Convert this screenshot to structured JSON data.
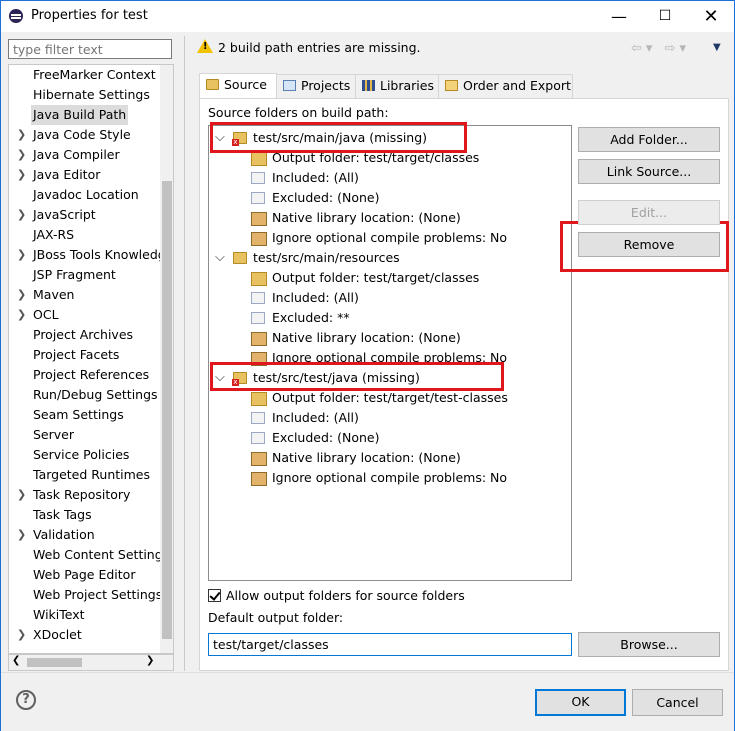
{
  "window": {
    "title": "Properties for test"
  },
  "left": {
    "filter_placeholder": "type filter text",
    "items": [
      {
        "label": "FreeMarker Context",
        "chevron": ""
      },
      {
        "label": "Hibernate Settings",
        "chevron": ""
      },
      {
        "label": "Java Build Path",
        "chevron": "",
        "selected": true
      },
      {
        "label": "Java Code Style",
        "chevron": ">"
      },
      {
        "label": "Java Compiler",
        "chevron": ">"
      },
      {
        "label": "Java Editor",
        "chevron": ">"
      },
      {
        "label": "Javadoc Location",
        "chevron": ""
      },
      {
        "label": "JavaScript",
        "chevron": ">"
      },
      {
        "label": "JAX-RS",
        "chevron": ""
      },
      {
        "label": "JBoss Tools Knowledg",
        "chevron": ">"
      },
      {
        "label": "JSP Fragment",
        "chevron": ""
      },
      {
        "label": "Maven",
        "chevron": ">"
      },
      {
        "label": "OCL",
        "chevron": ">"
      },
      {
        "label": "Project Archives",
        "chevron": ""
      },
      {
        "label": "Project Facets",
        "chevron": ""
      },
      {
        "label": "Project References",
        "chevron": ""
      },
      {
        "label": "Run/Debug Settings",
        "chevron": ""
      },
      {
        "label": "Seam Settings",
        "chevron": ""
      },
      {
        "label": "Server",
        "chevron": ""
      },
      {
        "label": "Service Policies",
        "chevron": ""
      },
      {
        "label": "Targeted Runtimes",
        "chevron": ""
      },
      {
        "label": "Task Repository",
        "chevron": ">"
      },
      {
        "label": "Task Tags",
        "chevron": ""
      },
      {
        "label": "Validation",
        "chevron": ">"
      },
      {
        "label": "Web Content Settings",
        "chevron": ""
      },
      {
        "label": "Web Page Editor",
        "chevron": ""
      },
      {
        "label": "Web Project Settings",
        "chevron": ""
      },
      {
        "label": "WikiText",
        "chevron": ""
      },
      {
        "label": "XDoclet",
        "chevron": ">"
      }
    ]
  },
  "header": {
    "warning": "2 build path entries are missing."
  },
  "tabs": [
    "Source",
    "Projects",
    "Libraries",
    "Order and Export"
  ],
  "source": {
    "label": "Source folders on build path:",
    "rows": [
      {
        "text": "test/src/main/java (missing)",
        "level": 0,
        "icon": "package-folder-error-icon"
      },
      {
        "text": "Output folder: test/target/classes",
        "level": 1,
        "icon": "output-folder-icon"
      },
      {
        "text": "Included: (All)",
        "level": 1,
        "icon": "included-filter-icon"
      },
      {
        "text": "Excluded: (None)",
        "level": 1,
        "icon": "excluded-filter-icon"
      },
      {
        "text": "Native library location: (None)",
        "level": 1,
        "icon": "native-library-icon"
      },
      {
        "text": "Ignore optional compile problems: No",
        "level": 1,
        "icon": "ignore-problems-icon"
      },
      {
        "text": "test/src/main/resources",
        "level": 0,
        "icon": "package-folder-icon"
      },
      {
        "text": "Output folder: test/target/classes",
        "level": 1,
        "icon": "output-folder-icon"
      },
      {
        "text": "Included: (All)",
        "level": 1,
        "icon": "included-filter-icon"
      },
      {
        "text": "Excluded: **",
        "level": 1,
        "icon": "excluded-filter-icon"
      },
      {
        "text": "Native library location: (None)",
        "level": 1,
        "icon": "native-library-icon"
      },
      {
        "text": "Ignore optional compile problems: No",
        "level": 1,
        "icon": "ignore-problems-icon"
      },
      {
        "text": "test/src/test/java (missing)",
        "level": 0,
        "icon": "package-folder-error-icon"
      },
      {
        "text": "Output folder: test/target/test-classes",
        "level": 1,
        "icon": "output-folder-icon"
      },
      {
        "text": "Included: (All)",
        "level": 1,
        "icon": "included-filter-icon"
      },
      {
        "text": "Excluded: (None)",
        "level": 1,
        "icon": "excluded-filter-icon"
      },
      {
        "text": "Native library location: (None)",
        "level": 1,
        "icon": "native-library-icon"
      },
      {
        "text": "Ignore optional compile problems: No",
        "level": 1,
        "icon": "ignore-problems-icon"
      }
    ],
    "buttons": {
      "add": "Add Folder...",
      "link": "Link Source...",
      "edit": "Edit...",
      "remove": "Remove"
    },
    "allow_output": "Allow output folders for source folders",
    "default_output_label": "Default output folder:",
    "default_output_value": "test/target/classes",
    "browse": "Browse..."
  },
  "footer": {
    "ok": "OK",
    "cancel": "Cancel"
  },
  "colors": {
    "highlight_box": "#e0161d",
    "focus": "#0078d7"
  }
}
